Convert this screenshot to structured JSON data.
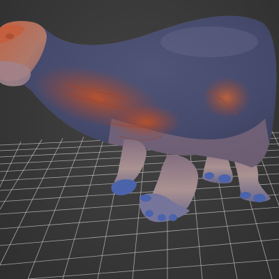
{
  "viewport": {
    "kind": "3d-model-viewport",
    "background_color": "#3a3a3a",
    "grid": {
      "visible": true,
      "color": "#cfcfcf"
    }
  },
  "model": {
    "subject": "dinosaur-sauropod",
    "shading": "heatmap-texture",
    "colors": {
      "body_top": "#4a4f73",
      "body_mid": "#6a5f78",
      "warm_patch": "#b24a2e",
      "belly_blue": "#3d56a8",
      "skin_light": "#b79a98",
      "feet": "#4f69b5"
    }
  }
}
